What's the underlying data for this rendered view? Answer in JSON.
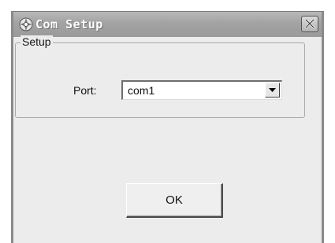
{
  "window": {
    "title": "Com Setup",
    "icon": "app-gear-icon",
    "close_icon": "close-icon"
  },
  "setup_group": {
    "label": "Setup",
    "port_label": "Port:",
    "port_value": "com1",
    "dropdown_icon": "chevron-down-icon"
  },
  "buttons": {
    "ok_label": "OK"
  }
}
